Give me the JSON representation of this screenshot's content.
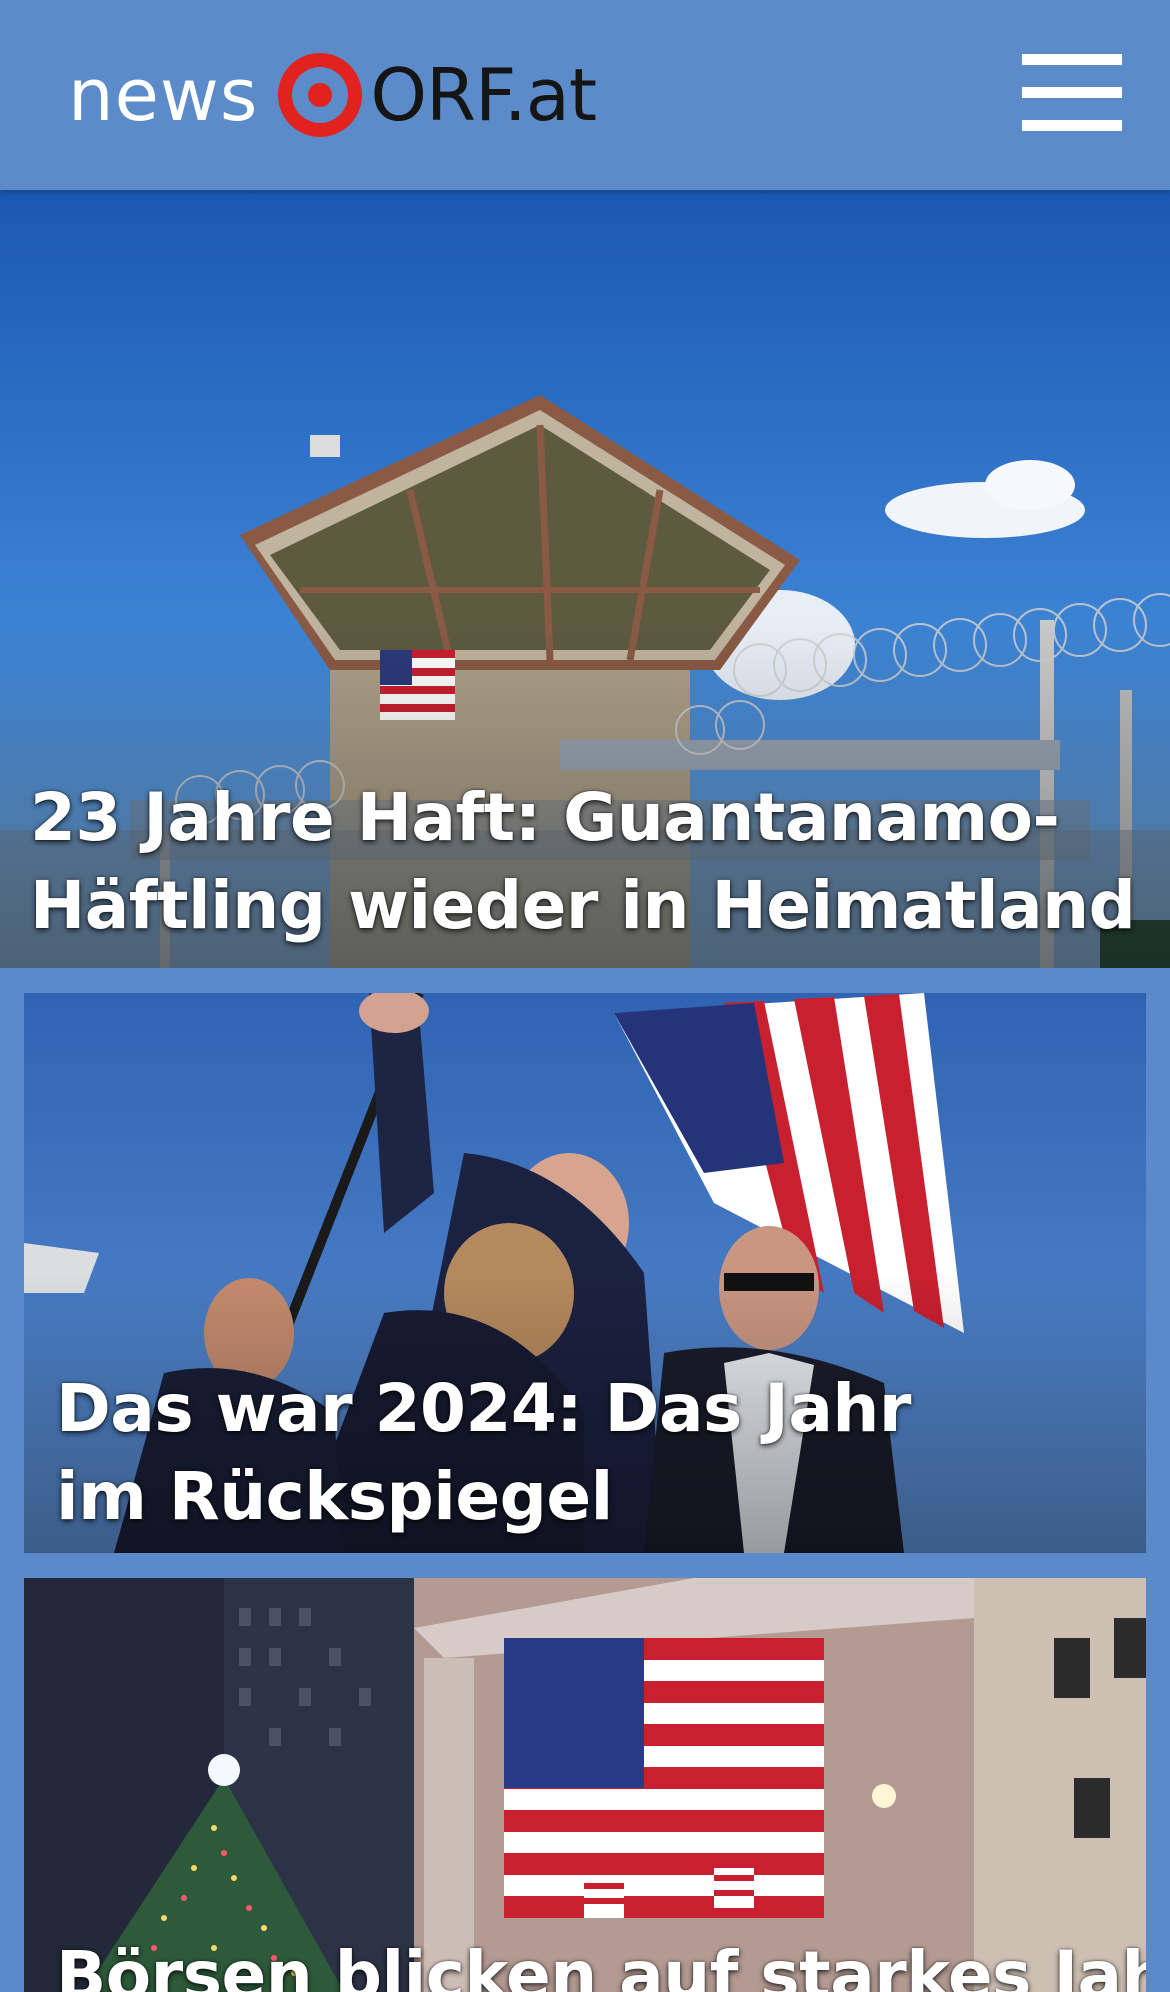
{
  "header": {
    "logo_news": "news",
    "logo_orf": "ORF.at",
    "menu_icon": "hamburger-menu-icon"
  },
  "stories": [
    {
      "title": "23 Jahre Haft: Guantanamo-Häftling wieder in Heimatland",
      "image": "guard-tower-razor-wire-photo"
    },
    {
      "title": "Das war 2024: Das Jahr im Rückspiegel",
      "image": "rally-security-flag-photo"
    },
    {
      "title": "Börsen blicken auf starkes Jahr",
      "image": "stock-exchange-flag-photo"
    }
  ],
  "colors": {
    "header_bg": "#5c8bca",
    "page_bg": "#5a8ac9",
    "logo_red": "#e2221f",
    "title_text": "#ffffff"
  }
}
